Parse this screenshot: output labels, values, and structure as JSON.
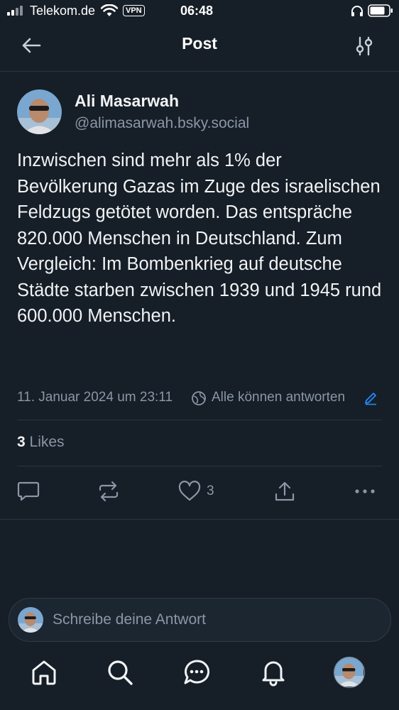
{
  "status_bar": {
    "carrier": "Telekom.de",
    "vpn": "VPN",
    "time": "06:48"
  },
  "header": {
    "title": "Post",
    "back_icon": "arrow-left-icon",
    "settings_icon": "sliders-icon"
  },
  "post": {
    "author_name": "Ali Masarwah",
    "author_handle": "@alimasarwah.bsky.social",
    "text": "Inzwischen sind mehr als 1% der Bevölkerung Gazas im Zuge des israelischen Feldzugs getötet worden. Das entspräche 820.000 Menschen in Deutschland. Zum Vergleich: Im Bombenkrieg auf deutsche Städte starben zwischen 1939 und 1945 rund 600.000 Menschen.",
    "date": "11. Januar 2024 um 23:11",
    "reply_setting": "Alle können antworten",
    "likes_count": "3",
    "likes_label": "Likes"
  },
  "actions": {
    "reply_icon": "comment-icon",
    "repost_icon": "repost-icon",
    "like_icon": "heart-icon",
    "like_count": "3",
    "share_icon": "share-icon",
    "more_icon": "more-icon"
  },
  "reply_bar": {
    "placeholder": "Schreibe deine Antwort"
  },
  "tabs": [
    "home-icon",
    "search-icon",
    "chat-icon",
    "bell-icon",
    "profile-avatar"
  ],
  "colors": {
    "background": "#161e27",
    "text": "#f1f3f5",
    "muted": "#8a97a6",
    "accent": "#208bfe",
    "divider": "#2a3643"
  }
}
